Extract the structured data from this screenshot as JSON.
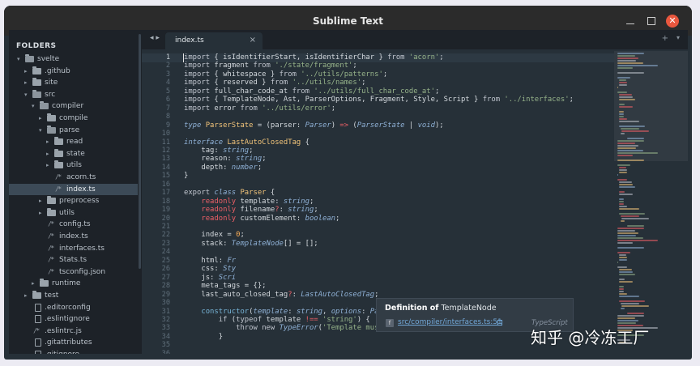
{
  "window": {
    "title": "Sublime Text",
    "close_glyph": "✕"
  },
  "sidebar": {
    "header": "FOLDERS",
    "items": [
      {
        "label": "svelte",
        "depth": 0,
        "kind": "folder",
        "open": true
      },
      {
        "label": ".github",
        "depth": 1,
        "kind": "folder",
        "open": false
      },
      {
        "label": "site",
        "depth": 1,
        "kind": "folder",
        "open": false
      },
      {
        "label": "src",
        "depth": 1,
        "kind": "folder",
        "open": true
      },
      {
        "label": "compiler",
        "depth": 2,
        "kind": "folder",
        "open": true
      },
      {
        "label": "compile",
        "depth": 3,
        "kind": "folder",
        "open": false
      },
      {
        "label": "parse",
        "depth": 3,
        "kind": "folder",
        "open": true
      },
      {
        "label": "read",
        "depth": 4,
        "kind": "folder",
        "open": false
      },
      {
        "label": "state",
        "depth": 4,
        "kind": "folder",
        "open": false
      },
      {
        "label": "utils",
        "depth": 4,
        "kind": "folder",
        "open": false
      },
      {
        "label": "acorn.ts",
        "depth": 4,
        "kind": "code"
      },
      {
        "label": "index.ts",
        "depth": 4,
        "kind": "code",
        "selected": true
      },
      {
        "label": "preprocess",
        "depth": 3,
        "kind": "folder",
        "open": false
      },
      {
        "label": "utils",
        "depth": 3,
        "kind": "folder",
        "open": false
      },
      {
        "label": "config.ts",
        "depth": 3,
        "kind": "code"
      },
      {
        "label": "index.ts",
        "depth": 3,
        "kind": "code"
      },
      {
        "label": "interfaces.ts",
        "depth": 3,
        "kind": "code"
      },
      {
        "label": "Stats.ts",
        "depth": 3,
        "kind": "code"
      },
      {
        "label": "tsconfig.json",
        "depth": 3,
        "kind": "code"
      },
      {
        "label": "runtime",
        "depth": 2,
        "kind": "folder",
        "open": false
      },
      {
        "label": "test",
        "depth": 1,
        "kind": "folder",
        "open": false
      },
      {
        "label": ".editorconfig",
        "depth": 1,
        "kind": "file"
      },
      {
        "label": ".eslintignore",
        "depth": 1,
        "kind": "file"
      },
      {
        "label": ".eslintrc.js",
        "depth": 1,
        "kind": "code"
      },
      {
        "label": ".gitattributes",
        "depth": 1,
        "kind": "file"
      },
      {
        "label": ".gitignore",
        "depth": 1,
        "kind": "file"
      }
    ]
  },
  "tabs": {
    "nav": "◂ ▸",
    "active": "index.ts",
    "close": "×",
    "plus": "+",
    "dropdown": "▾"
  },
  "editor": {
    "current_line": 1,
    "lines": [
      [
        [
          "import",
          "kw"
        ],
        [
          " { isIdentifierStart, isIdentifierChar } ",
          ""
        ],
        [
          "from",
          "kw"
        ],
        [
          " ",
          ""
        ],
        [
          "'acorn'",
          "str"
        ],
        [
          ";",
          ""
        ]
      ],
      [
        [
          "import",
          "kw"
        ],
        [
          " fragment ",
          ""
        ],
        [
          "from",
          "kw"
        ],
        [
          " ",
          ""
        ],
        [
          "'./state/fragment'",
          "str"
        ],
        [
          ";",
          ""
        ]
      ],
      [
        [
          "import",
          "kw"
        ],
        [
          " { whitespace } ",
          ""
        ],
        [
          "from",
          "kw"
        ],
        [
          " ",
          ""
        ],
        [
          "'../utils/patterns'",
          "str"
        ],
        [
          ";",
          ""
        ]
      ],
      [
        [
          "import",
          "kw"
        ],
        [
          " { reserved } ",
          ""
        ],
        [
          "from",
          "kw"
        ],
        [
          " ",
          ""
        ],
        [
          "'../utils/names'",
          "str"
        ],
        [
          ";",
          ""
        ]
      ],
      [
        [
          "import",
          "kw"
        ],
        [
          " full_char_code_at ",
          ""
        ],
        [
          "from",
          "kw"
        ],
        [
          " ",
          ""
        ],
        [
          "'../utils/full_char_code_at'",
          "str"
        ],
        [
          ";",
          ""
        ]
      ],
      [
        [
          "import",
          "kw"
        ],
        [
          " { TemplateNode, Ast, ParserOptions, Fragment, Style, Script } ",
          ""
        ],
        [
          "from",
          "kw"
        ],
        [
          " ",
          ""
        ],
        [
          "'../interfaces'",
          "str"
        ],
        [
          ";",
          ""
        ]
      ],
      [
        [
          "import",
          "kw"
        ],
        [
          " error ",
          ""
        ],
        [
          "from",
          "kw"
        ],
        [
          " ",
          ""
        ],
        [
          "'../utils/error'",
          "str"
        ],
        [
          ";",
          ""
        ]
      ],
      [],
      [
        [
          "type",
          "typ"
        ],
        [
          " ",
          ""
        ],
        [
          "ParserState",
          "cls"
        ],
        [
          " = (parser: ",
          ""
        ],
        [
          "Parser",
          "typ"
        ],
        [
          ") ",
          ""
        ],
        [
          "=>",
          "op"
        ],
        [
          " (",
          ""
        ],
        [
          "ParserState",
          "typ"
        ],
        [
          " | ",
          ""
        ],
        [
          "void",
          "typ"
        ],
        [
          ");",
          ""
        ]
      ],
      [],
      [
        [
          "interface",
          "typ"
        ],
        [
          " ",
          ""
        ],
        [
          "LastAutoClosedTag",
          "cls"
        ],
        [
          " {",
          ""
        ]
      ],
      [
        [
          "    tag: ",
          ""
        ],
        [
          "string",
          "typ"
        ],
        [
          ";",
          ""
        ]
      ],
      [
        [
          "    reason: ",
          ""
        ],
        [
          "string",
          "typ"
        ],
        [
          ";",
          ""
        ]
      ],
      [
        [
          "    depth: ",
          ""
        ],
        [
          "number",
          "typ"
        ],
        [
          ";",
          ""
        ]
      ],
      [
        [
          "}",
          ""
        ]
      ],
      [],
      [
        [
          "export",
          "kw"
        ],
        [
          " ",
          ""
        ],
        [
          "class",
          "typ"
        ],
        [
          " ",
          ""
        ],
        [
          "Parser",
          "cls"
        ],
        [
          " {",
          ""
        ]
      ],
      [
        [
          "    ",
          ""
        ],
        [
          "readonly",
          "ro"
        ],
        [
          " template: ",
          ""
        ],
        [
          "string",
          "typ"
        ],
        [
          ";",
          ""
        ]
      ],
      [
        [
          "    ",
          ""
        ],
        [
          "readonly",
          "ro"
        ],
        [
          " filename",
          ""
        ],
        [
          "?",
          "op"
        ],
        [
          ": ",
          ""
        ],
        [
          "string",
          "typ"
        ],
        [
          ";",
          ""
        ]
      ],
      [
        [
          "    ",
          ""
        ],
        [
          "readonly",
          "ro"
        ],
        [
          " customElement: ",
          ""
        ],
        [
          "boolean",
          "typ"
        ],
        [
          ";",
          ""
        ]
      ],
      [],
      [
        [
          "    index = ",
          ""
        ],
        [
          "0",
          "num"
        ],
        [
          ";",
          ""
        ]
      ],
      [
        [
          "    stack: ",
          ""
        ],
        [
          "TemplateNode",
          "typ"
        ],
        [
          "[] = [];",
          ""
        ]
      ],
      [],
      [
        [
          "    html: ",
          ""
        ],
        [
          "Fr",
          "typ"
        ]
      ],
      [
        [
          "    css: ",
          ""
        ],
        [
          "Sty",
          "typ"
        ]
      ],
      [
        [
          "    js: ",
          ""
        ],
        [
          "Scri",
          "typ"
        ]
      ],
      [
        [
          "    meta_tags = {};",
          ""
        ]
      ],
      [
        [
          "    last_auto_closed_tag",
          ""
        ],
        [
          "?",
          "op"
        ],
        [
          ": ",
          ""
        ],
        [
          "LastAutoClosedTag",
          "typ"
        ],
        [
          ";",
          ""
        ]
      ],
      [],
      [
        [
          "    ",
          ""
        ],
        [
          "constructor",
          "fn"
        ],
        [
          "(",
          ""
        ],
        [
          "template",
          "typ"
        ],
        [
          ": ",
          ""
        ],
        [
          "string",
          "typ"
        ],
        [
          ", ",
          ""
        ],
        [
          "options",
          "typ"
        ],
        [
          ": ",
          ""
        ],
        [
          "ParserOptions",
          "typ"
        ],
        [
          ") {",
          ""
        ]
      ],
      [
        [
          "        ",
          ""
        ],
        [
          "if",
          "kw"
        ],
        [
          " (",
          ""
        ],
        [
          "typeof",
          "kw"
        ],
        [
          " template ",
          ""
        ],
        [
          "!==",
          "op"
        ],
        [
          " ",
          ""
        ],
        [
          "'string'",
          "str"
        ],
        [
          ") {",
          ""
        ]
      ],
      [
        [
          "            ",
          ""
        ],
        [
          "throw",
          "kw"
        ],
        [
          " ",
          ""
        ],
        [
          "new",
          "kw"
        ],
        [
          " ",
          ""
        ],
        [
          "TypeError",
          "typ"
        ],
        [
          "(",
          ""
        ],
        [
          "'Template must be a string'",
          "str"
        ],
        [
          ");",
          ""
        ]
      ],
      [
        [
          "        }",
          ""
        ]
      ],
      [],
      [
        [
          "                          .        .  .",
          ""
        ]
      ]
    ]
  },
  "tooltip": {
    "title_bold": "Definition of",
    "title_rest": " TemplateNode",
    "badge": "f",
    "link": "src/compiler/interfaces.ts:51",
    "lang": "TypeScript"
  },
  "watermark": "知乎 @冷冻工厂",
  "colors": {
    "editor_bg": "#263038",
    "sidebar_bg": "#1d2228",
    "titlebar_bg": "#2b2b2b",
    "close_button": "#e9573e",
    "keyword": "#c0c5ce",
    "string": "#96b38a",
    "class_name": "#f2c47a",
    "type": "#8fb1d6",
    "operator": "#ec5f66",
    "number": "#f9ae58",
    "link": "#72a8d8"
  }
}
